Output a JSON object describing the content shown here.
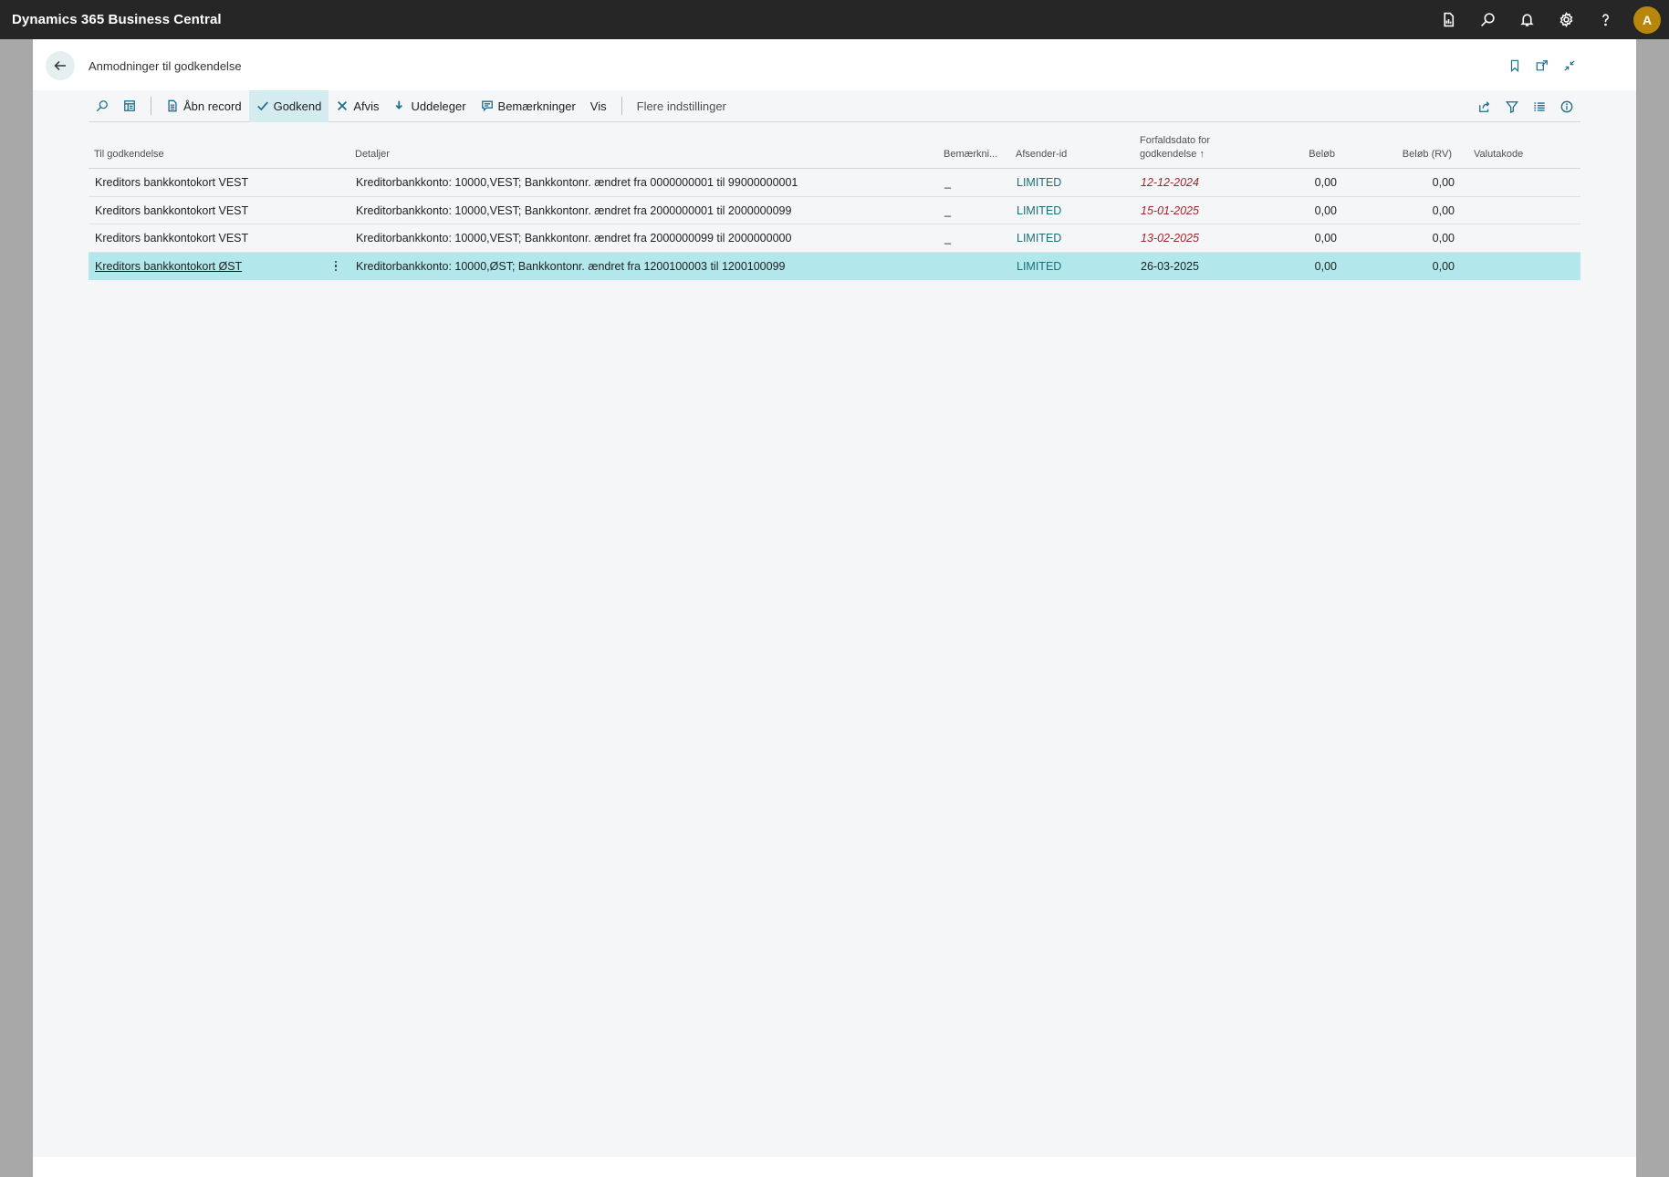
{
  "app": {
    "title": "Dynamics 365 Business Central",
    "avatar_initial": "A"
  },
  "topbar_icons": [
    "report-icon",
    "search-icon",
    "bell-icon",
    "gear-icon",
    "help-icon"
  ],
  "page": {
    "title": "Anmodninger til godkendelse"
  },
  "actions": {
    "open_record": "Åbn record",
    "approve": "Godkend",
    "reject": "Afvis",
    "delegate": "Uddeleger",
    "comments": "Bemærkninger",
    "view": "Vis",
    "more_options": "Flere indstillinger"
  },
  "columns": {
    "to_approve": "Til godkendelse",
    "details": "Detaljer",
    "comments": "Bemærkni...",
    "sender_id": "Afsender-id",
    "due_date_line1": "Forfaldsdato for",
    "due_date_line2": "godkendelse ↑",
    "amount": "Beløb",
    "amount_lcy": "Beløb (RV)",
    "currency": "Valutakode"
  },
  "rows": [
    {
      "to_approve": "Kreditors bankkontokort VEST",
      "details": "Kreditorbankkonto: 10000,VEST; Bankkontonr. ændret fra 0000000001 til 99000000001",
      "comments": "_",
      "sender": "LIMITED",
      "due": "12-12-2024",
      "amount": "0,00",
      "amount_lcy": "0,00",
      "currency": ""
    },
    {
      "to_approve": "Kreditors bankkontokort VEST",
      "details": "Kreditorbankkonto: 10000,VEST; Bankkontonr. ændret fra 2000000001 til 2000000099",
      "comments": "_",
      "sender": "LIMITED",
      "due": "15-01-2025",
      "amount": "0,00",
      "amount_lcy": "0,00",
      "currency": ""
    },
    {
      "to_approve": "Kreditors bankkontokort VEST",
      "details": "Kreditorbankkonto: 10000,VEST; Bankkontonr. ændret fra 2000000099 til 2000000000",
      "comments": "_",
      "sender": "LIMITED",
      "due": "13-02-2025",
      "amount": "0,00",
      "amount_lcy": "0,00",
      "currency": ""
    },
    {
      "to_approve": "Kreditors bankkontokort ØST",
      "details": "Kreditorbankkonto: 10000,ØST; Bankkontonr. ændret fra 1200100003 til 1200100099",
      "comments": "",
      "sender": "LIMITED",
      "due": "26-03-2025",
      "amount": "0,00",
      "amount_lcy": "0,00",
      "currency": ""
    }
  ],
  "colors": {
    "accent": "#1f6e8c",
    "selected_row": "#b2e8ec",
    "overdue": "#a4262c",
    "topbar": "#262626"
  }
}
